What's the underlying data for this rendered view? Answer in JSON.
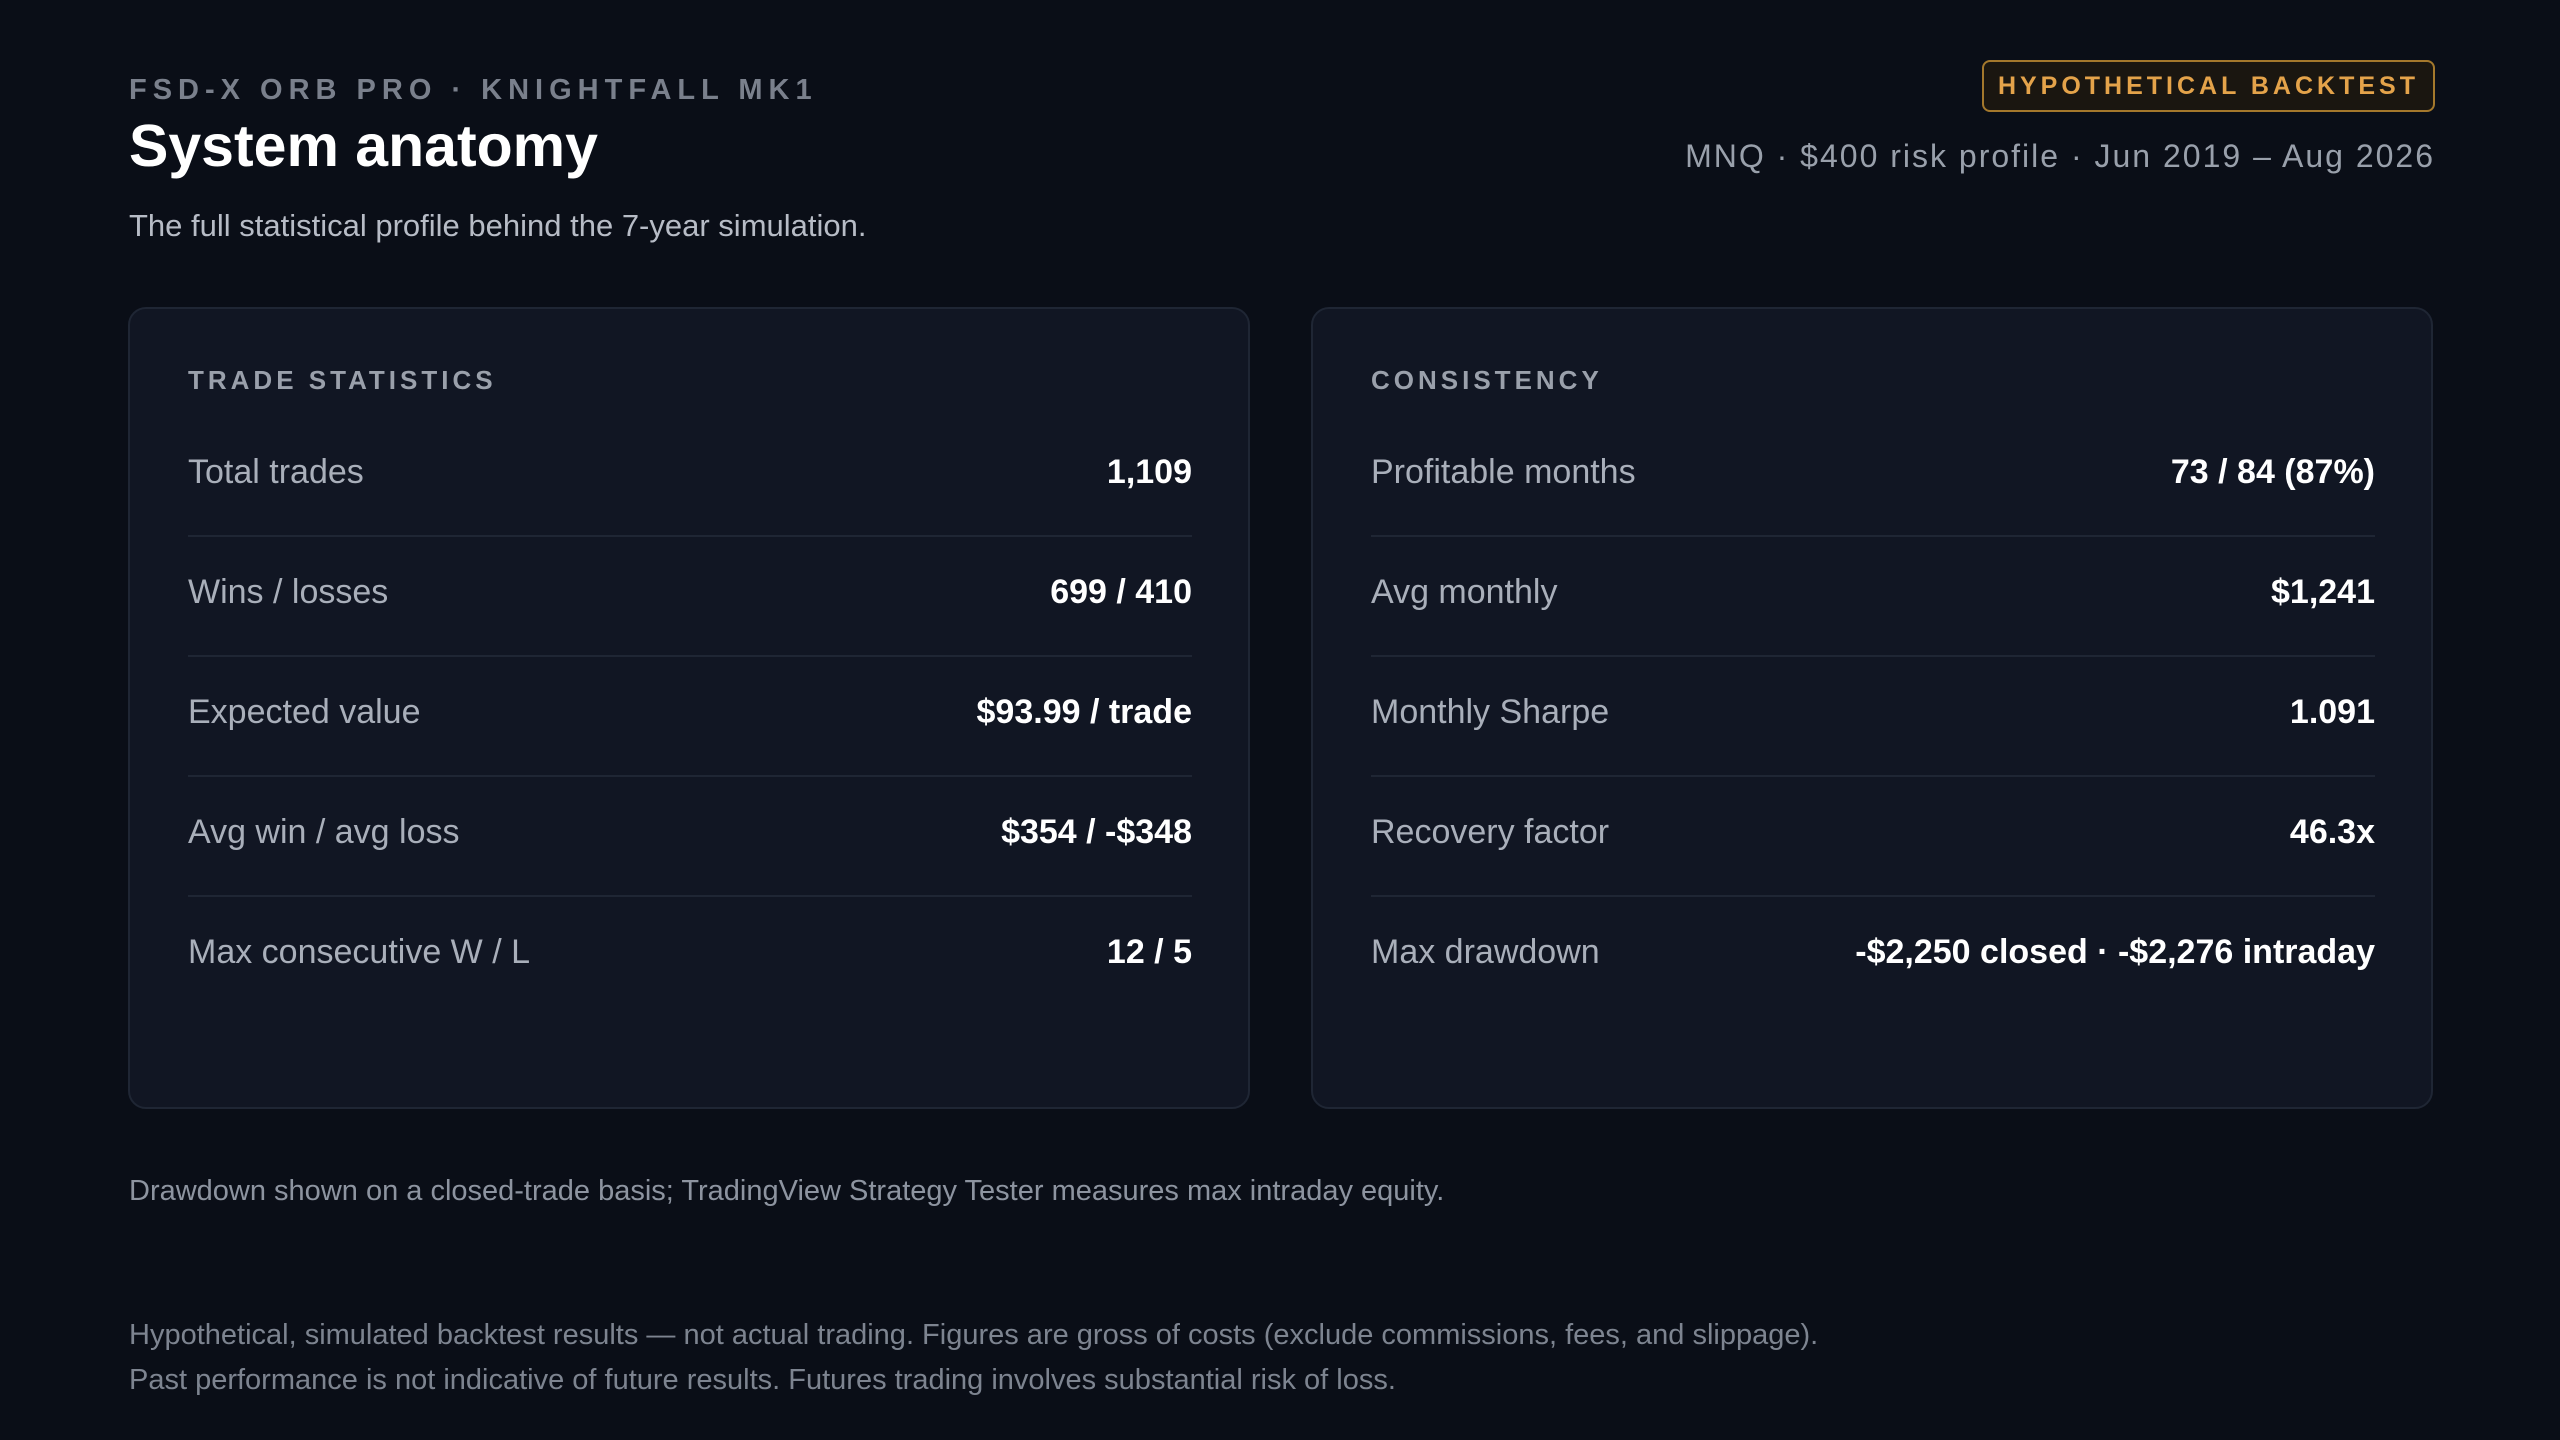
{
  "header": {
    "eyebrow": "FSD-X ORB PRO · KNIGHTFALL MK1",
    "title": "System anatomy",
    "subtitle": "The full statistical profile behind the 7-year simulation.",
    "badge": "HYPOTHETICAL BACKTEST",
    "meta": "MNQ · $400 risk profile · Jun 2019 – Aug 2026"
  },
  "trade_statistics": {
    "heading": "TRADE STATISTICS",
    "rows": [
      {
        "label": "Total trades",
        "value": "1,109"
      },
      {
        "label": "Wins / losses",
        "value": "699 / 410"
      },
      {
        "label": "Expected value",
        "value": "$93.99 / trade"
      },
      {
        "label": "Avg win / avg loss",
        "value": "$354 / -$348"
      },
      {
        "label": "Max consecutive W / L",
        "value": "12 / 5"
      }
    ]
  },
  "consistency": {
    "heading": "CONSISTENCY",
    "rows": [
      {
        "label": "Profitable months",
        "value": "73 / 84 (87%)"
      },
      {
        "label": "Avg monthly",
        "value": "$1,241"
      },
      {
        "label": "Monthly Sharpe",
        "value": "1.091"
      },
      {
        "label": "Recovery factor",
        "value": "46.3x"
      },
      {
        "label": "Max drawdown",
        "value": "-$2,250 closed · -$2,276 intraday"
      }
    ]
  },
  "footnote": "Drawdown shown on a closed-trade basis; TradingView Strategy Tester measures max intraday equity.",
  "disclaimer": {
    "line1": "Hypothetical, simulated backtest results — not actual trading. Figures are gross of costs (exclude commissions, fees, and slippage).",
    "line2": "Past performance is not indicative of future results. Futures trading involves substantial risk of loss."
  },
  "colors": {
    "background": "#0a0e17",
    "card": "#111623",
    "badge_accent": "#e4a34a"
  }
}
